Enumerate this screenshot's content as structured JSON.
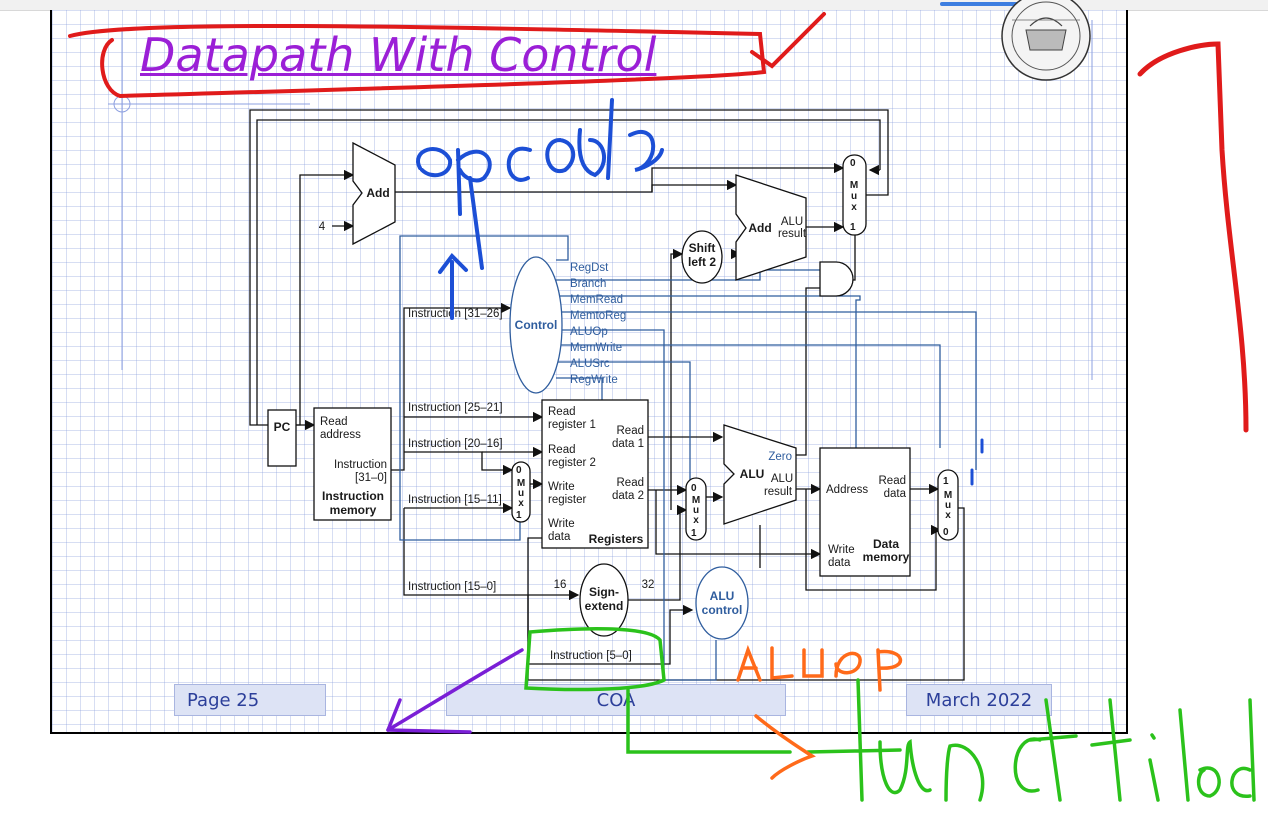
{
  "slide": {
    "title": "Datapath With Control",
    "footer_page": "Page 25",
    "footer_course": "COA",
    "footer_date": "March 2022"
  },
  "diagram": {
    "pc_label": "PC",
    "add_label": "Add",
    "constant_four": "4",
    "add2_label": "Add",
    "alu_result": "ALU",
    "result_word": "result",
    "shift_left_line1": "Shift",
    "shift_left_line2": "left 2",
    "control_label": "Control",
    "control_signals": [
      "RegDst",
      "Branch",
      "MemRead",
      "MemtoReg",
      "ALUOp",
      "MemWrite",
      "ALUSrc",
      "RegWrite"
    ],
    "imem_read": "Read",
    "imem_address": "address",
    "imem_instruction": "Instruction",
    "imem_bits": "[31–0]",
    "imem_name1": "Instruction",
    "imem_name2": "memory",
    "instr_31_26": "Instruction [31–26]",
    "instr_25_21": "Instruction [25–21]",
    "instr_20_16": "Instruction [20–16]",
    "instr_15_11": "Instruction [15–11]",
    "instr_15_0": "Instruction [15–0]",
    "instr_5_0": "Instruction [5–0]",
    "reg_read_register1": "Read",
    "reg_register1": "register 1",
    "reg_read_register2": "Read",
    "reg_register2": "register 2",
    "reg_write": "Write",
    "reg_register": "register",
    "reg_write_data": "Write",
    "reg_data": "data",
    "reg_read_data1": "Read",
    "reg_data1": "data 1",
    "reg_read_data2": "Read",
    "reg_data2": "data 2",
    "registers_label": "Registers",
    "alu_label": "ALU",
    "zero_label": "Zero",
    "alu_result_label": "ALU",
    "alu_result_word": "result",
    "sign_extend1": "Sign-",
    "sign_extend2": "extend",
    "bits_16": "16",
    "bits_32": "32",
    "alu_control1": "ALU",
    "alu_control2": "control",
    "dmem_address": "Address",
    "dmem_read": "Read",
    "dmem_data": "data",
    "dmem_write": "Write",
    "dmem_write_data": "data",
    "dmem_name1": "Data",
    "dmem_name2": "memory",
    "mux_letters": [
      "M",
      "u",
      "x"
    ],
    "mux_zero": "0",
    "mux_one": "1"
  },
  "annotations": {
    "opcode": "opcode",
    "aluop": "ALUop",
    "funct_field": "funct field",
    "colors": {
      "red": "#e01b1b",
      "purple": "#7a1fd6",
      "blue": "#1c4fd6",
      "green": "#2bc21b",
      "orange": "#ff6a1a"
    }
  }
}
